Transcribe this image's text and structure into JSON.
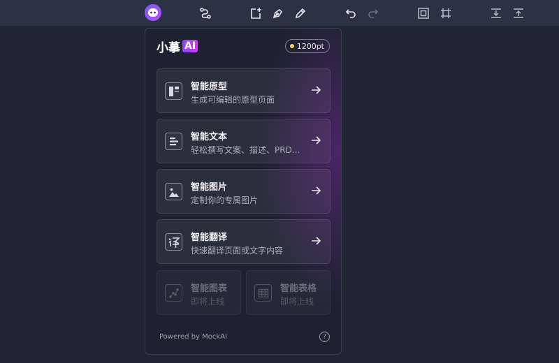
{
  "toolbar": {
    "icons": [
      "ai-avatar-icon",
      "connector-icon",
      "add-frame-icon",
      "pen-icon",
      "pencil-icon",
      "undo-icon",
      "redo-icon",
      "frame-icon",
      "group-frame-icon",
      "align-bottom-icon",
      "align-top-icon"
    ]
  },
  "panel": {
    "brand_cn": "小摹",
    "brand_ai": "AI",
    "points": "1200pt",
    "cards": [
      {
        "title": "智能原型",
        "subtitle": "生成可编辑的原型页面",
        "icon": "layout-icon"
      },
      {
        "title": "智能文本",
        "subtitle": "轻松撰写文案、描述、PRD...",
        "icon": "text-icon"
      },
      {
        "title": "智能图片",
        "subtitle": "定制你的专属图片",
        "icon": "image-icon"
      },
      {
        "title": "智能翻译",
        "subtitle": "快速翻译页面或文字内容",
        "icon": "translate-icon"
      }
    ],
    "upcoming": [
      {
        "title": "智能图表",
        "subtitle": "即将上线",
        "icon": "chart-icon"
      },
      {
        "title": "智能表格",
        "subtitle": "即将上线",
        "icon": "table-icon"
      }
    ],
    "footer": "Powered by MockAI",
    "help": "?",
    "colors": {
      "accent": "#8b46ff",
      "accent2": "#d23bf0",
      "points_dot": "#ffd84a"
    }
  }
}
